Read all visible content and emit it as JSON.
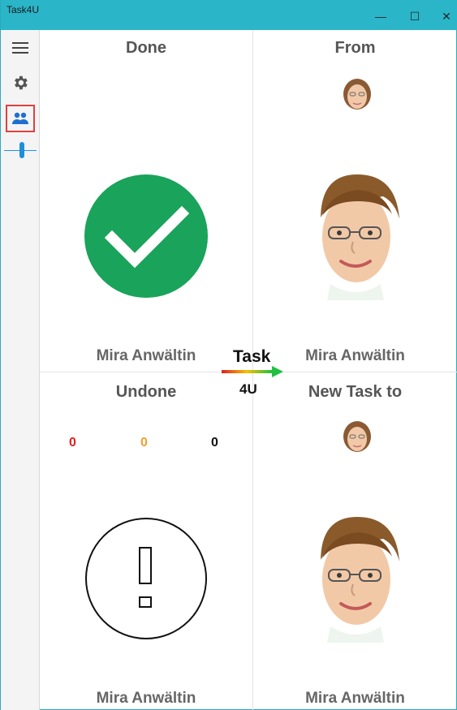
{
  "window": {
    "title": "Task4U",
    "minimize": "—",
    "maximize": "☐",
    "close": "✕"
  },
  "sidebar": {
    "items": [
      {
        "icon": "hamburger-menu-icon"
      },
      {
        "icon": "gear-icon"
      },
      {
        "icon": "people-icon",
        "selected": true
      }
    ]
  },
  "done": {
    "header": "Done",
    "person": "Mira Anwältin"
  },
  "from": {
    "header": "From",
    "person": "Mira Anwältin"
  },
  "undone": {
    "header": "Undone",
    "person": "Mira Anwältin",
    "counts": [
      {
        "value": "0",
        "color": "#e02020"
      },
      {
        "value": "0",
        "color": "#f0a030"
      },
      {
        "value": "0",
        "color": "#111111"
      }
    ]
  },
  "new_task": {
    "header": "New Task to",
    "person": "Mira Anwältin"
  },
  "logo": {
    "line1": "Task",
    "line2": "4U"
  },
  "colors": {
    "titlebar": "#2bb5c8",
    "done_green": "#1aa35a",
    "accent": "#1e8fd8",
    "selected_border": "#e04040"
  }
}
